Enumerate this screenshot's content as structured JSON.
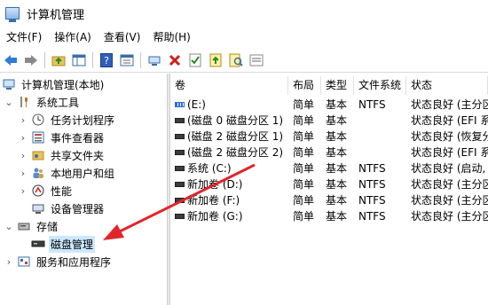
{
  "window": {
    "title": "计算机管理"
  },
  "menu": [
    "文件(F)",
    "操作(A)",
    "查看(V)",
    "帮助(H)"
  ],
  "toolbar": {
    "buttons": [
      "back-icon",
      "forward-icon",
      "up-folder-icon",
      "show-tree-icon",
      "help-icon",
      "properties-icon",
      "connect-icon",
      "delete-icon",
      "check-icon",
      "import-icon",
      "search-icon",
      "view-icon"
    ]
  },
  "tree": {
    "root": "计算机管理(本地)",
    "system_tools": "系统工具",
    "task_scheduler": "任务计划程序",
    "event_viewer": "事件查看器",
    "shared_folders": "共享文件夹",
    "local_users": "本地用户和组",
    "performance": "性能",
    "device_manager": "设备管理器",
    "storage": "存储",
    "disk_management": "磁盘管理",
    "services_apps": "服务和应用程序"
  },
  "table": {
    "columns": [
      "卷",
      "布局",
      "类型",
      "文件系统",
      "状态"
    ],
    "rows": [
      {
        "volume": "(E:)",
        "layout": "简单",
        "type": "基本",
        "fs": "NTFS",
        "status": "状态良好 (主分区)",
        "icon": "striped-disk"
      },
      {
        "volume": "(磁盘 0 磁盘分区 1)",
        "layout": "简单",
        "type": "基本",
        "fs": "",
        "status": "状态良好 (EFI 系",
        "icon": "disk"
      },
      {
        "volume": "(磁盘 2 磁盘分区 1)",
        "layout": "简单",
        "type": "基本",
        "fs": "",
        "status": "状态良好 (恢复分",
        "icon": "disk"
      },
      {
        "volume": "(磁盘 2 磁盘分区 2)",
        "layout": "简单",
        "type": "基本",
        "fs": "",
        "status": "状态良好 (EFI 系",
        "icon": "disk"
      },
      {
        "volume": "系统 (C:)",
        "layout": "简单",
        "type": "基本",
        "fs": "NTFS",
        "status": "状态良好 (启动, 页",
        "icon": "disk"
      },
      {
        "volume": "新加卷 (D:)",
        "layout": "简单",
        "type": "基本",
        "fs": "NTFS",
        "status": "状态良好 (主分区",
        "icon": "disk"
      },
      {
        "volume": "新加卷 (F:)",
        "layout": "简单",
        "type": "基本",
        "fs": "NTFS",
        "status": "状态良好 (主分区",
        "icon": "disk"
      },
      {
        "volume": "新加卷 (G:)",
        "layout": "简单",
        "type": "基本",
        "fs": "NTFS",
        "status": "状态良好 (主分区",
        "icon": "disk"
      }
    ]
  },
  "colors": {
    "selection": "#cce8ff",
    "annotation_arrow": "#e0262b"
  }
}
